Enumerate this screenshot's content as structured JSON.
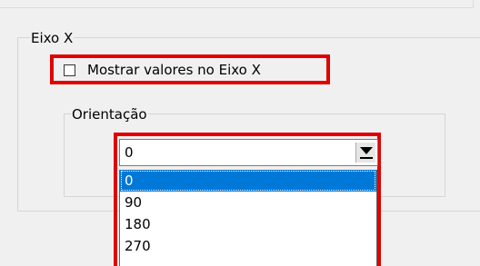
{
  "group_x_axis": {
    "legend": "Eixo X"
  },
  "show_values_checkbox": {
    "label": "Mostrar valores no Eixo X",
    "checked": false
  },
  "orientation_group": {
    "legend": "Orientação"
  },
  "orientation_combo": {
    "value": "0",
    "options": [
      "0",
      "90",
      "180",
      "270"
    ],
    "selected_index": 0
  },
  "colors": {
    "highlight": "#e00000",
    "selection": "#0078d7"
  }
}
